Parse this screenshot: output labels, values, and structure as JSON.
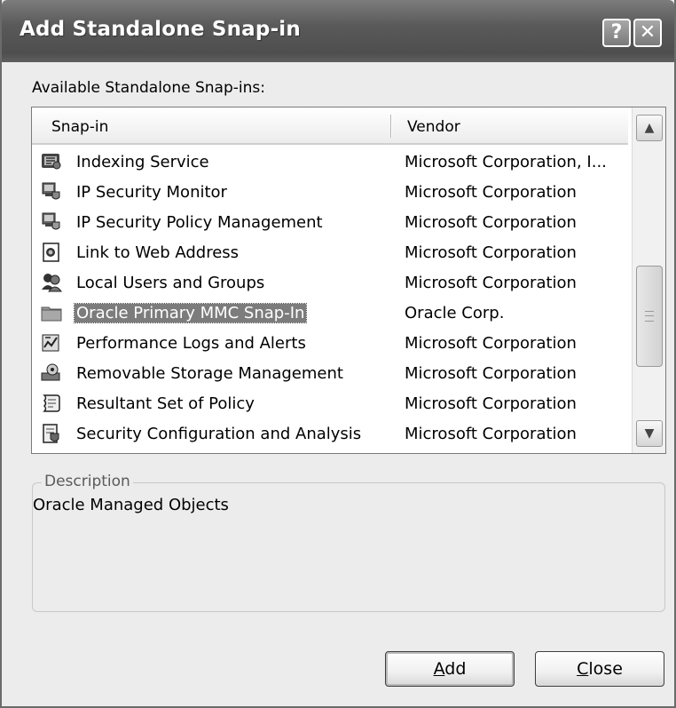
{
  "window": {
    "title": "Add Standalone Snap-in",
    "help_glyph": "?",
    "close_glyph": "✕"
  },
  "available_label": "Available Standalone Snap-ins:",
  "list": {
    "columns": [
      "Snap-in",
      "Vendor"
    ],
    "rows": [
      {
        "name": "Indexing Service",
        "vendor": "Microsoft Corporation, I...",
        "icon": "indexing-service-icon"
      },
      {
        "name": "IP Security Monitor",
        "vendor": "Microsoft Corporation",
        "icon": "ip-security-monitor-icon"
      },
      {
        "name": "IP Security Policy Management",
        "vendor": "Microsoft Corporation",
        "icon": "ip-security-policy-icon"
      },
      {
        "name": "Link to Web Address",
        "vendor": "Microsoft Corporation",
        "icon": "link-web-address-icon"
      },
      {
        "name": "Local Users and Groups",
        "vendor": "Microsoft Corporation",
        "icon": "local-users-groups-icon"
      },
      {
        "name": "Oracle Primary MMC Snap-In",
        "vendor": "Oracle Corp.",
        "icon": "folder-icon",
        "selected": true
      },
      {
        "name": "Performance Logs and Alerts",
        "vendor": "Microsoft Corporation",
        "icon": "performance-logs-icon"
      },
      {
        "name": "Removable Storage Management",
        "vendor": "Microsoft Corporation",
        "icon": "removable-storage-icon"
      },
      {
        "name": "Resultant Set of Policy",
        "vendor": "Microsoft Corporation",
        "icon": "resultant-policy-icon"
      },
      {
        "name": "Security Configuration and Analysis",
        "vendor": "Microsoft Corporation",
        "icon": "security-config-icon"
      }
    ]
  },
  "description": {
    "legend": "Description",
    "text": "Oracle Managed Objects"
  },
  "buttons": {
    "add": "Add",
    "close": "Close"
  }
}
